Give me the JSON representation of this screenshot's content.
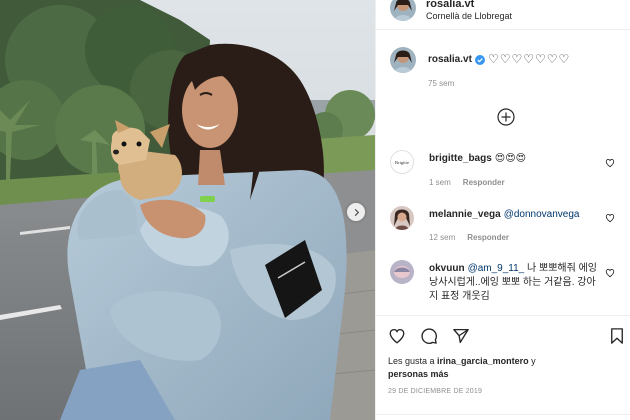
{
  "header": {
    "username": "rosalia.vt",
    "location": "Cornellà de Llobregat"
  },
  "caption": {
    "username": "rosalia.vt",
    "text": "♡♡♡♡♡♡♡",
    "time": "75 sem"
  },
  "comments": [
    {
      "username": "brigitte_bags",
      "avatar_text": "Brigitte",
      "text": "😍😍😍",
      "time": "1 sem",
      "reply_label": "Responder"
    },
    {
      "username": "melannie_vega",
      "text": "@donnovanvega",
      "time": "12 sem",
      "reply_label": "Responder"
    },
    {
      "username": "okvuun",
      "mention": "@am_9_11_",
      "text": " 나 뽀뽀해줘 에잉 낭사시럽게..에잉 뽀뽀 하는 거같음. 강아지 표정 개웃김"
    }
  ],
  "likes": {
    "prefix": "Les gusta a ",
    "username": "irina_garcia_montero",
    "suffix": " y",
    "line2": "personas más"
  },
  "date": "29 DE DICIEMBRE DE 2019",
  "colors": {
    "verified": "#3897f0",
    "mention": "#00376b",
    "muted": "#8e8e8e",
    "border": "#efefef"
  },
  "icons": [
    "verified-badge-icon",
    "plus-circle-icon",
    "heart-icon",
    "comment-icon",
    "share-icon",
    "bookmark-icon",
    "chevron-right-icon"
  ]
}
